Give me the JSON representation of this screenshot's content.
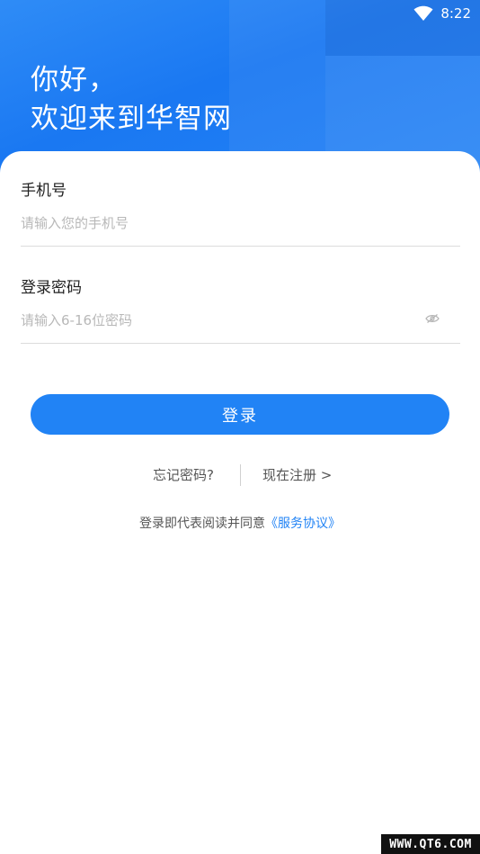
{
  "status_bar": {
    "time": "8:22",
    "wifi_icon": "wifi-icon"
  },
  "header": {
    "greeting_line1": "你好，",
    "greeting_line2": "欢迎来到华智网"
  },
  "phone": {
    "label": "手机号",
    "value": "",
    "placeholder": "请输入您的手机号"
  },
  "password": {
    "label": "登录密码",
    "value": "",
    "placeholder": "请输入6-16位密码",
    "toggle_icon": "eye-off-icon"
  },
  "login_button": {
    "label": "登录"
  },
  "links": {
    "forgot": "忘记密码?",
    "register": "现在注册 >"
  },
  "agreement": {
    "text": "登录即代表阅读并同意",
    "link": "《服务协议》"
  },
  "watermark": {
    "text": "WWW.QT6.COM"
  },
  "colors": {
    "primary": "#2183f5",
    "header_bg": "#1a78f2",
    "text_dark": "#222222",
    "text_muted": "#555555",
    "placeholder": "#b8b8b8"
  }
}
